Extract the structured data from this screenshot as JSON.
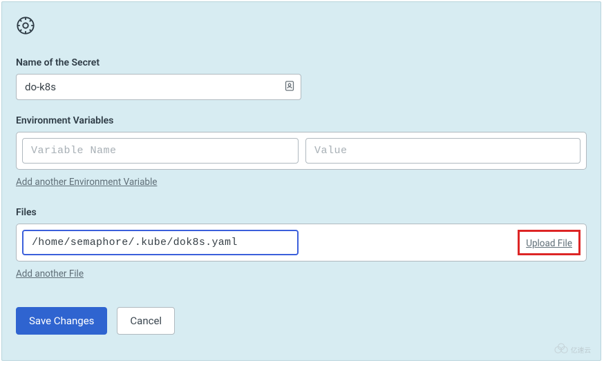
{
  "labels": {
    "name_of_secret": "Name of the Secret",
    "environment_variables": "Environment Variables",
    "files": "Files"
  },
  "secret": {
    "name_value": "do-k8s"
  },
  "env": {
    "variable_name_placeholder": "Variable Name",
    "value_placeholder": "Value",
    "add_link": "Add another Environment Variable"
  },
  "files_section": {
    "path_value": "/home/semaphore/.kube/dok8s.yaml",
    "upload_label": "Upload File",
    "add_link": "Add another File"
  },
  "buttons": {
    "save": "Save Changes",
    "cancel": "Cancel"
  },
  "watermark_text": "亿速云"
}
